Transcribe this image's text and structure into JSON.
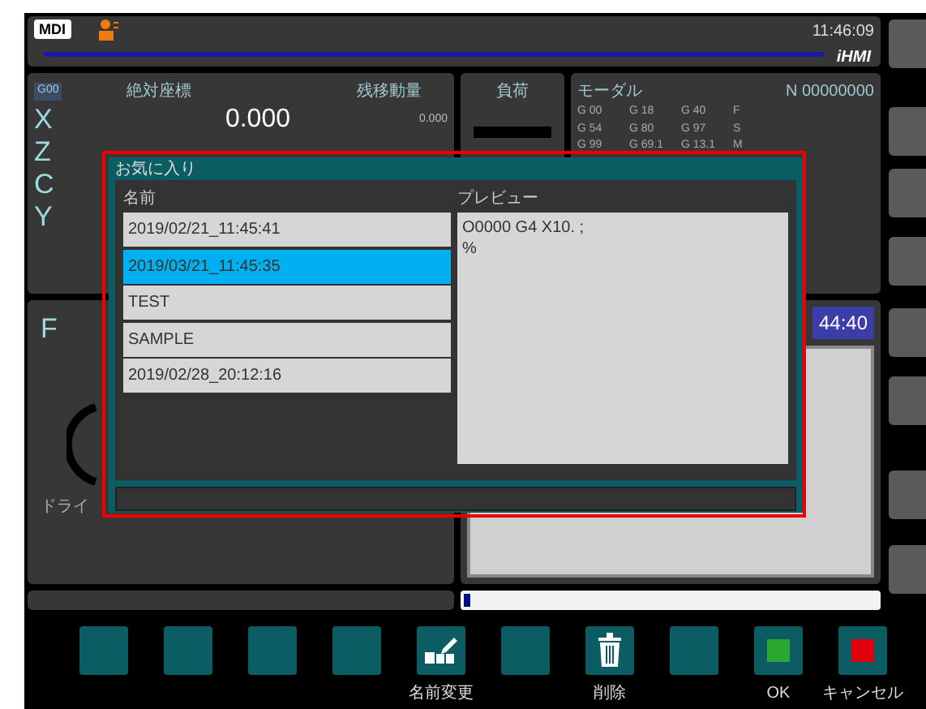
{
  "header": {
    "mode": "MDI",
    "time": "11:46:09",
    "brand": "iHMI"
  },
  "position": {
    "status": "G00",
    "absolute_title": "絶対座標",
    "remaining_title": "残移動量",
    "axes": [
      {
        "name": "X",
        "absolute": "0.000",
        "remaining": "0.000"
      },
      {
        "name": "Z"
      },
      {
        "name": "C"
      },
      {
        "name": "Y"
      }
    ]
  },
  "load": {
    "title": "負荷"
  },
  "modal": {
    "title": "モーダル",
    "sequence": "N 00000000",
    "codes": [
      [
        "G 00",
        "G 18",
        "G 40",
        "F"
      ],
      [
        "G 54",
        "G 80",
        "G 97",
        "S"
      ],
      [
        "G 99",
        "G 69.1",
        "G 13.1",
        "M"
      ]
    ]
  },
  "feed": {
    "label": "F",
    "caption": "ドライ"
  },
  "clock_badge": "44:40",
  "dialog": {
    "title": "お気に入り",
    "list_header": "名前",
    "preview_header": "プレビュー",
    "items": [
      {
        "label": "2019/02/21_11:45:41",
        "selected": false
      },
      {
        "label": "2019/03/21_11:45:35",
        "selected": true
      },
      {
        "label": "TEST",
        "selected": false
      },
      {
        "label": "SAMPLE",
        "selected": false
      },
      {
        "label": "2019/02/28_20:12:16",
        "selected": false
      }
    ],
    "preview_lines": [
      "O0000 G4 X10. ;",
      "%"
    ]
  },
  "softkeys": [
    {
      "kind": "blank"
    },
    {
      "kind": "blank"
    },
    {
      "kind": "blank"
    },
    {
      "kind": "blank"
    },
    {
      "kind": "rename",
      "label": "名前変更"
    },
    {
      "kind": "blank"
    },
    {
      "kind": "delete",
      "label": "削除"
    },
    {
      "kind": "blank"
    },
    {
      "kind": "ok",
      "label": "OK"
    },
    {
      "kind": "cancel",
      "label": "キャンセル"
    }
  ]
}
